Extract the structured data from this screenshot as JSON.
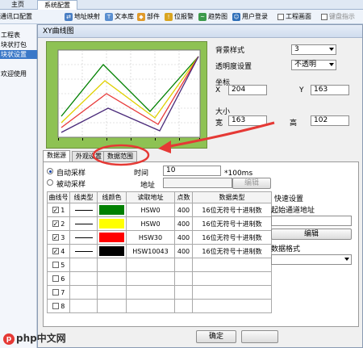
{
  "top_tabs": [
    "主页",
    "系统配置"
  ],
  "toolbar": {
    "items": [
      "通讯口配置",
      "地址映射",
      "文本库",
      "部件",
      "位报警",
      "趋势图",
      "用户登录",
      "工程画面",
      "键盘指示"
    ]
  },
  "sidebar": {
    "items": [
      "工程表",
      "块状打包",
      "块状设置",
      "欢迎使用"
    ]
  },
  "dialog": {
    "title": "XY曲线图",
    "bg_style_label": "背景样式",
    "bg_style_value": "3",
    "transparency_label": "透明度设置",
    "transparency_value": "不透明",
    "coord_label": "坐标",
    "x_label": "X",
    "x_value": "204",
    "y_label": "Y",
    "y_value": "163",
    "size_label": "大小",
    "width_label": "宽",
    "width_value": "163",
    "height_label": "高",
    "height_value": "102",
    "tabs": [
      "数据源",
      "外观设置",
      "数据范围"
    ],
    "auto_sample": "自动采样",
    "passive_sample": "被动采样",
    "time_label": "时间",
    "time_value": "10",
    "time_unit": "*100ms",
    "address_label": "地址",
    "edit_btn": "编辑",
    "columns": [
      "曲线号",
      "线类型",
      "线颜色",
      "读取地址",
      "点数",
      "数据类型"
    ],
    "rows": [
      {
        "no": "1",
        "checked": true,
        "color": "#008000",
        "addr": "HSW0",
        "points": "400",
        "type": "16位无符号十进制数"
      },
      {
        "no": "2",
        "checked": true,
        "color": "#ffff00",
        "addr": "HSW0",
        "points": "400",
        "type": "16位无符号十进制数"
      },
      {
        "no": "3",
        "checked": true,
        "color": "#ff0000",
        "addr": "HSW30",
        "points": "400",
        "type": "16位无符号十进制数"
      },
      {
        "no": "4",
        "checked": true,
        "color": "#000000",
        "addr": "HSW10043",
        "points": "400",
        "type": "16位无符号十进制数"
      },
      {
        "no": "5",
        "checked": false,
        "color": "",
        "addr": "",
        "points": "",
        "type": ""
      },
      {
        "no": "6",
        "checked": false,
        "color": "",
        "addr": "",
        "points": "",
        "type": ""
      },
      {
        "no": "7",
        "checked": false,
        "color": "",
        "addr": "",
        "points": "",
        "type": ""
      },
      {
        "no": "8",
        "checked": false,
        "color": "",
        "addr": "",
        "points": "",
        "type": ""
      }
    ],
    "quick_settings": "快速设置",
    "start_addr_label": "起始通道地址",
    "edit_btn2": "编辑",
    "data_format_label": "数据格式",
    "ok_btn": "确定"
  },
  "watermark": "php中文网",
  "colors": {
    "preview_bg": "#8ec253",
    "annotation": "#e53935",
    "selection": "#3a78c8"
  }
}
